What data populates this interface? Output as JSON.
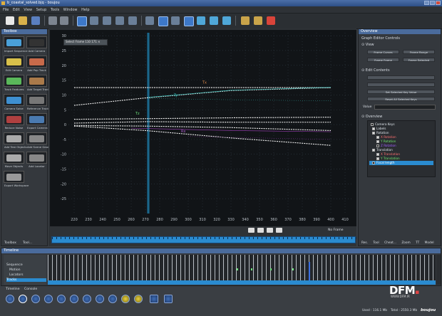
{
  "window": {
    "title": "b_coastal_solved.bjq - boujou",
    "controls": [
      "minimize",
      "maximize",
      "close"
    ]
  },
  "menu": [
    "File",
    "Edit",
    "View",
    "Setup",
    "Tools",
    "Window",
    "Help"
  ],
  "toolbox": {
    "header": "Toolbox",
    "tools": [
      {
        "label": "Import Sequence",
        "icon": "film-strip-icon"
      },
      {
        "label": "Add Camera",
        "icon": "camera-icon"
      },
      {
        "label": "Edit Camera",
        "icon": "camera-settings-icon"
      },
      {
        "label": "Add Pop Track",
        "icon": "pop-track-icon"
      },
      {
        "label": "Track Features",
        "icon": "track-features-icon"
      },
      {
        "label": "Add Target Track",
        "icon": "target-track-icon"
      },
      {
        "label": "Camera Solve",
        "icon": "camera-solve-icon"
      },
      {
        "label": "Reference Tracks",
        "icon": "reference-tracks-icon"
      },
      {
        "label": "Reduce Noise",
        "icon": "reduce-noise-icon"
      },
      {
        "label": "Export Camera",
        "icon": "export-camera-icon"
      },
      {
        "label": "Add Test Objects",
        "icon": "test-objects-icon"
      },
      {
        "label": "Add Scene Geometry",
        "icon": "scene-geometry-icon"
      },
      {
        "label": "Move Objects",
        "icon": "move-objects-icon"
      },
      {
        "label": "Add Locator",
        "icon": "locator-icon"
      },
      {
        "label": "Export Workspace",
        "icon": "export-workspace-icon"
      }
    ],
    "bottom_tabs": [
      "Toolbox",
      "Tool..."
    ]
  },
  "graph": {
    "zoom_value": "27%",
    "selection_tooltip": "Select Frame 110 171",
    "playback_status": "No Frame",
    "y_ticks": [
      "30",
      "25",
      "20",
      "15",
      "10",
      "5",
      "0",
      "-5",
      "-10",
      "-15",
      "-20",
      "-25"
    ],
    "x_ticks": [
      "220",
      "230",
      "240",
      "250",
      "260",
      "270",
      "280",
      "290",
      "300",
      "310",
      "320",
      "330",
      "340",
      "350",
      "360",
      "370",
      "380",
      "390",
      "400",
      "410"
    ],
    "curve_labels": [
      "Tx",
      "Ty",
      "Tz",
      "Rx"
    ],
    "chart_data": {
      "type": "line",
      "x": [
        220,
        270,
        330,
        400
      ],
      "ylim": [
        -30,
        31
      ],
      "xlim": [
        216,
        416
      ],
      "series": [
        {
          "values": [
            12.5,
            12.5,
            12.5,
            12.5
          ]
        },
        {
          "values": [
            6.5,
            9.0,
            11.5,
            12.5
          ]
        },
        {
          "values": [
            1.8,
            2.0,
            2.3,
            2.5
          ]
        },
        {
          "values": [
            0.5,
            1.0,
            0.8,
            0.8
          ]
        },
        {
          "values": [
            -0.3,
            -0.5,
            -1.0,
            -2.0
          ]
        },
        {
          "values": [
            -0.5,
            -2.0,
            -4.5,
            -7.0
          ]
        }
      ]
    }
  },
  "right_panel": {
    "header": "Graph Editor Controls",
    "sections": {
      "view": "View",
      "edit_contents": "Edit Contents",
      "value_label": "Value",
      "overview": "Overview"
    },
    "buttons": [
      "Frame Curves",
      "Frame Range",
      "Frame Frame",
      "Frame Selected",
      "Set Selected Key Value",
      "Reset All Selected Keys"
    ],
    "tree": [
      {
        "label": "Camera Keys",
        "checked": false,
        "color": "#dfe6ec"
      },
      {
        "label": "Labels",
        "checked": true,
        "color": "#dfe6ec"
      },
      {
        "label": "Rotation",
        "checked": true,
        "color": "#dfe6ec"
      },
      {
        "label": "X Rotation",
        "checked": true,
        "color": "#ff7070"
      },
      {
        "label": "Y Rotation",
        "checked": true,
        "color": "#70e870"
      },
      {
        "label": "Z Rotation",
        "checked": false,
        "color": "#a060ff"
      },
      {
        "label": "Translation",
        "checked": true,
        "color": "#dfe6ec"
      },
      {
        "label": "X Translation",
        "checked": true,
        "color": "#ff7070"
      },
      {
        "label": "Y Translation",
        "checked": true,
        "color": "#70e870"
      },
      {
        "label": "Focal length",
        "checked": false,
        "color": "#ffffff"
      }
    ],
    "bottom_tabs": [
      "Res. Tool",
      "Cheat...",
      "Zoom",
      "TT",
      "Model"
    ]
  },
  "timeline": {
    "header": "Timeline",
    "rows": [
      "Sequence",
      "Motion",
      "Locators",
      "Tracks"
    ],
    "tabs": [
      "Timeline",
      "Console"
    ]
  },
  "status": {
    "brand": "DFM",
    "brand_sub": "WWW.DFM.IR",
    "used": "Used : 116.1 Mb",
    "total": "Total : 2550.3 Mb",
    "app": "boujou"
  },
  "colors": {
    "accent": "#4a6b9c",
    "graph_bg": "#111417",
    "cursor": "#2b9bd1",
    "teal_curve": "#2fb6b0",
    "green_label": "#6de27c"
  }
}
